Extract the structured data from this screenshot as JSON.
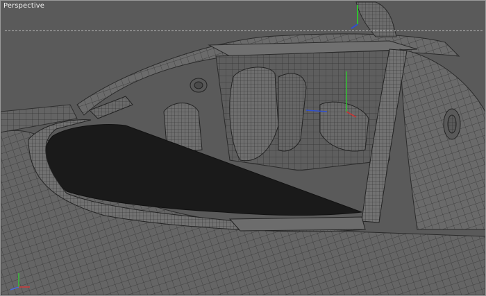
{
  "viewport": {
    "label": "Perspective",
    "label_color": "#f0f0f0",
    "background": "#5a5a5a",
    "wire_color": "#2e2e2e",
    "mesh_fill": "#6a6a6a",
    "windshield_fill": "#1a1a1a"
  },
  "gizmo": {
    "axes": [
      "x-axis",
      "y-axis",
      "z-axis"
    ],
    "x_color": "#d23a3a",
    "y_color": "#3ac23a",
    "z_color": "#4a6ae0"
  },
  "pivot_marker": {
    "x_color": "#d03030",
    "y_color": "#30c030",
    "z_color": "#3050d0"
  }
}
